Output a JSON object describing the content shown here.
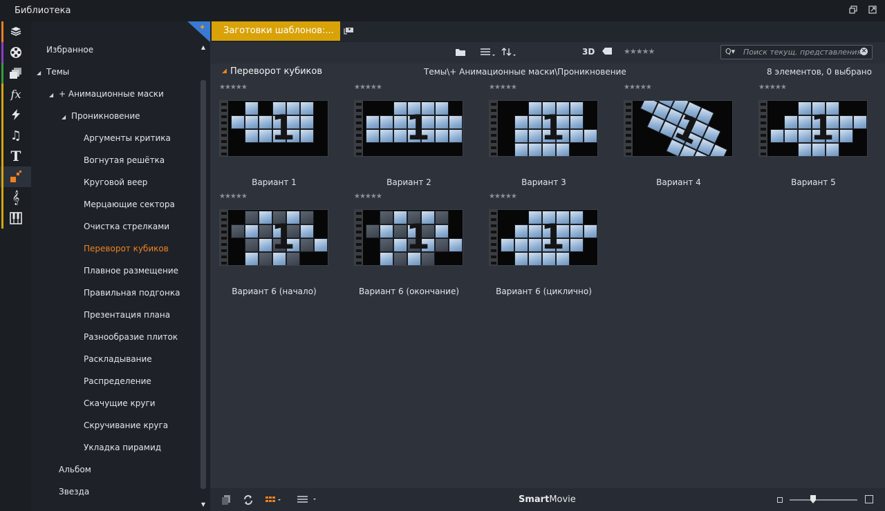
{
  "window": {
    "title": "Библиотека"
  },
  "sidebar_categories": [
    {
      "icon": "box-stack-icon",
      "color": "#e87f26"
    },
    {
      "icon": "film-reel-icon",
      "color": "#8a3ec4"
    },
    {
      "icon": "montage-copies-icon",
      "color": "#3a9b3a"
    },
    {
      "icon": "fx-effects-icon",
      "color": "#d6a70a"
    },
    {
      "icon": "lightning-transitions-icon",
      "color": "#d6a70a"
    },
    {
      "icon": "music-note-icon",
      "color": "#d6a70a"
    },
    {
      "icon": "title-text-icon",
      "color": "#d6a70a"
    },
    {
      "icon": "themes-squares-icon",
      "color": "#d6a70a"
    },
    {
      "icon": "treble-clef-icon",
      "color": "#d6a70a"
    },
    {
      "icon": "piano-keys-icon",
      "color": "#d6a70a"
    }
  ],
  "tree": {
    "favorites": "Избранное",
    "themes": "Темы",
    "animated_masks": "+ Анимационные маски",
    "penetration": "Проникновение",
    "children": [
      "Аргументы критика",
      "Вогнутая решётка",
      "Круговой веер",
      "Мерцающие сектора",
      "Очистка стрелками",
      "Переворот кубиков",
      "Плавное размещение",
      "Правильная подгонка",
      "Презентация плана",
      "Разнообразие плиток",
      "Раскладывание",
      "Распределение",
      "Скачущие круги",
      "Скручивание круга",
      "Укладка пирамид"
    ],
    "selected": "Переворот кубиков",
    "album": "Альбом",
    "star": "Звезда"
  },
  "tabs": {
    "active_label": "Заготовки шаблонов:..."
  },
  "toolbar": {
    "label_3d": "3D",
    "rating_stars": "★★★★★",
    "search_placeholder": "Поиск текущ. представления",
    "search_prefix": "Q▾"
  },
  "header": {
    "title": "Переворот кубиков",
    "path": "Темы\\+ Анимационные маски\\Проникновение",
    "count": "8 элементов, 0 выбрано"
  },
  "items": [
    {
      "label": "Вариант 1",
      "stars": "★★★★★",
      "digit": "1"
    },
    {
      "label": "Вариант 2",
      "stars": "★★★★★",
      "digit": "1"
    },
    {
      "label": "Вариант 3",
      "stars": "★★★★★",
      "digit": "1"
    },
    {
      "label": "Вариант 4",
      "stars": "★★★★★",
      "digit": "1"
    },
    {
      "label": "Вариант 5",
      "stars": "★★★★★",
      "digit": "1"
    },
    {
      "label": "Вариант 6 (начало)",
      "stars": "★★★★★",
      "digit": "1"
    },
    {
      "label": "Вариант 6 (окончание)",
      "stars": "★★★★★",
      "digit": "1"
    },
    {
      "label": "Вариант 6 (циклично)",
      "stars": "★★★★★",
      "digit": "1"
    }
  ],
  "bottom": {
    "brand_bold": "Smart",
    "brand_rest": "Movie"
  },
  "colors": {
    "accent_orange": "#f0821e",
    "tab_yellow": "#d8a208",
    "panel_bg": "#2d323b"
  }
}
